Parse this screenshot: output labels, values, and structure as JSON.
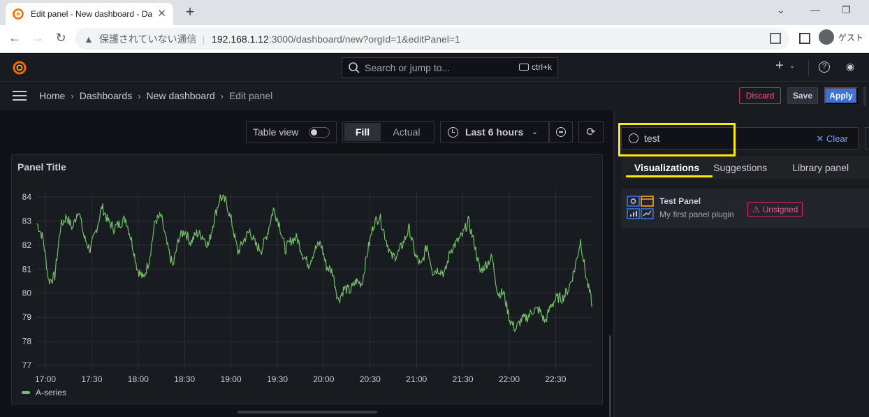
{
  "browser": {
    "tab_title": "Edit panel - New dashboard - Da",
    "security_label": "保護されていない通信",
    "url_host": "192.168.1.12",
    "url_rest": ":3000/dashboard/new?orgId=1&editPanel=1",
    "profile_label": "ゲスト"
  },
  "topnav": {
    "search_placeholder": "Search or jump to...",
    "shortcut": "ctrl+k"
  },
  "breadcrumb": {
    "items": [
      "Home",
      "Dashboards",
      "New dashboard"
    ],
    "current": "Edit panel"
  },
  "actions": {
    "discard": "Discard",
    "save": "Save",
    "apply": "Apply"
  },
  "toolbar": {
    "table_view": "Table view",
    "fill": "Fill",
    "actual": "Actual",
    "time_range": "Last 6 hours"
  },
  "panel": {
    "title": "Panel Title"
  },
  "chart_data": {
    "type": "line",
    "series": [
      {
        "name": "A-series",
        "color": "#73bf69",
        "values": [
          82.9,
          82.3,
          80.5,
          80.7,
          82.8,
          83.2,
          82.7,
          83.5,
          82.3,
          81.8,
          82.6,
          83.6,
          83.0,
          82.7,
          82.9,
          83.1,
          82.2,
          81.0,
          80.6,
          81.4,
          83.0,
          83.2,
          82.0,
          81.1,
          82.3,
          82.6,
          82.1,
          82.5,
          82.4,
          82.0,
          83.1,
          84.0,
          83.8,
          82.9,
          81.7,
          82.2,
          82.6,
          82.0,
          81.8,
          82.5,
          83.5,
          82.9,
          81.8,
          82.2,
          82.3,
          81.6,
          81.2,
          81.8,
          82.1,
          81.1,
          80.9,
          79.7,
          80.2,
          80.1,
          80.5,
          80.4,
          81.8,
          82.9,
          83.2,
          82.3,
          81.5,
          81.6,
          82.1,
          82.7,
          81.6,
          81.1,
          82.0,
          80.9,
          81.0,
          80.8,
          81.8,
          82.1,
          82.4,
          83.0,
          82.1,
          80.9,
          81.2,
          81.5,
          80.0,
          80.0,
          78.9,
          78.5,
          78.9,
          79.0,
          79.3,
          79.3,
          78.8,
          79.5,
          79.8,
          79.8,
          80.2,
          81.0,
          82.2,
          80.6,
          79.5
        ]
      }
    ],
    "x_ticks": [
      "17:00",
      "17:30",
      "18:00",
      "18:30",
      "19:00",
      "19:30",
      "20:00",
      "20:30",
      "21:00",
      "21:30",
      "22:00",
      "22:30"
    ],
    "ylim": [
      77,
      84
    ],
    "y_ticks": [
      84,
      83,
      82,
      81,
      80,
      79,
      78,
      77
    ],
    "grid": true,
    "legend": "bottom-left"
  },
  "options": {
    "search_value": "test",
    "clear_label": "Clear",
    "tabs": [
      "Visualizations",
      "Suggestions",
      "Library panel"
    ],
    "viz_name": "Test Panel",
    "viz_desc": "My first panel plugin",
    "badge": "Unsigned"
  },
  "colors": {
    "accent_blue": "#3d71d9",
    "danger": "#e0226e",
    "highlight": "#ffea00",
    "series_green": "#73bf69"
  }
}
